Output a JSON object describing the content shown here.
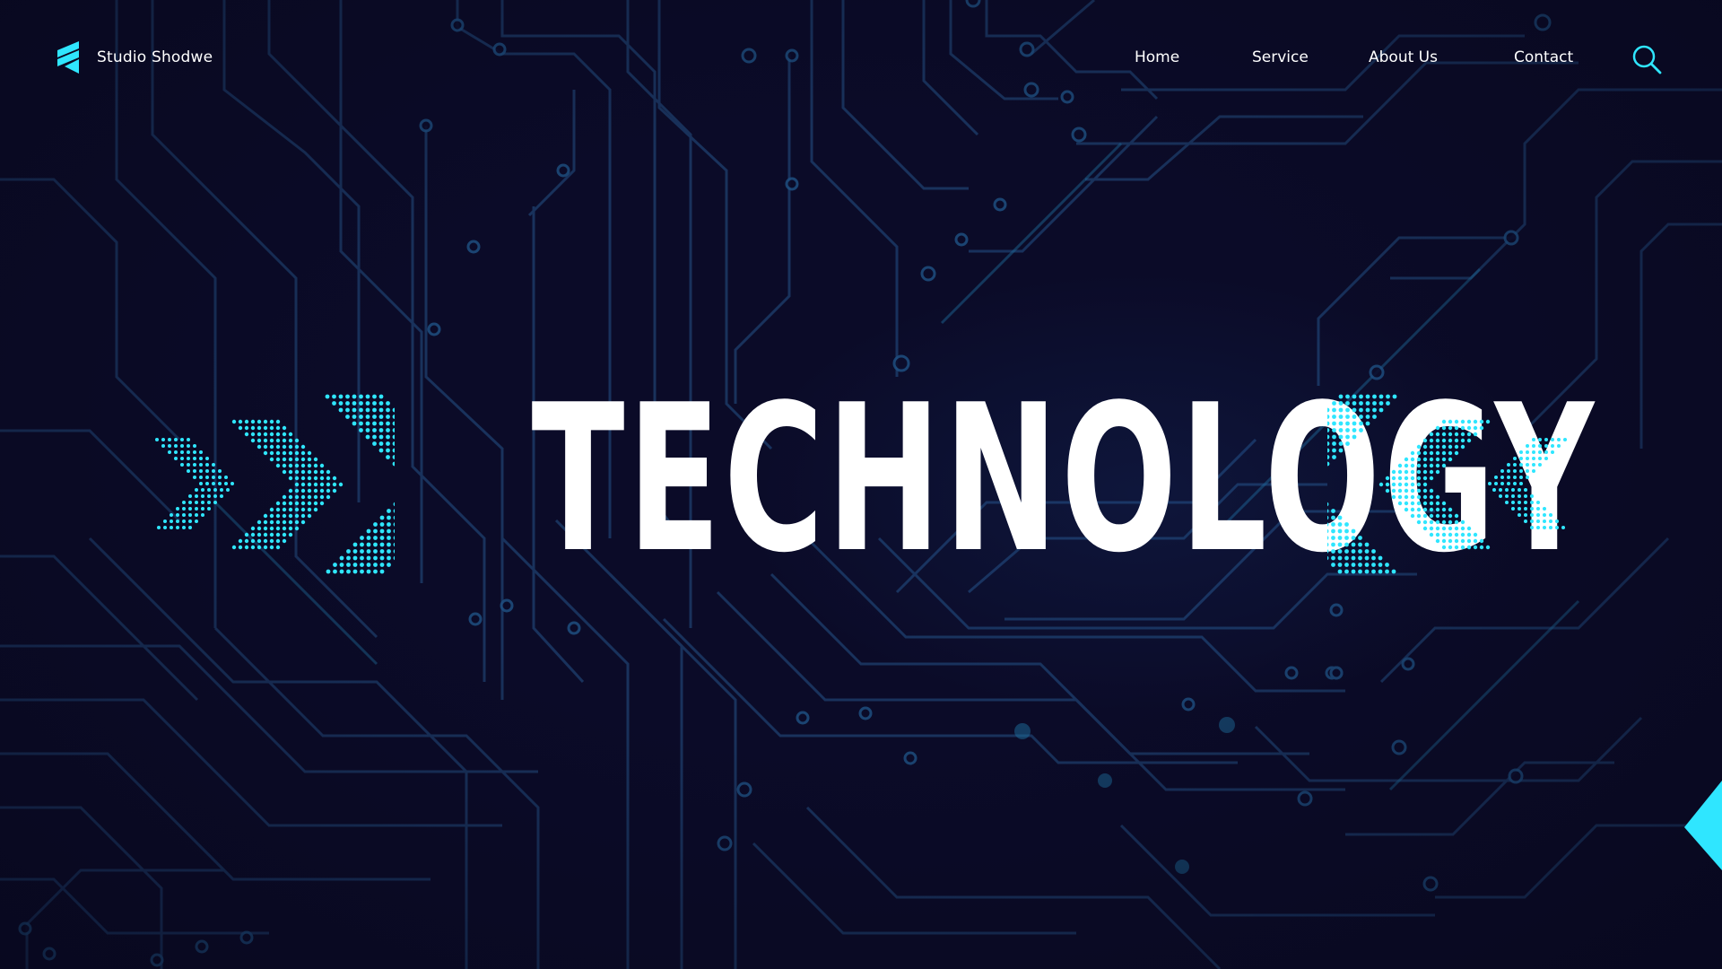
{
  "brand": {
    "name": "Studio Shodwe",
    "logo_icon": "stacked-stripes-logo-icon"
  },
  "nav": {
    "items": [
      {
        "label": "Home"
      },
      {
        "label": "Service"
      },
      {
        "label": "About Us"
      },
      {
        "label": "Contact"
      }
    ],
    "search_icon": "search-icon"
  },
  "hero": {
    "title": "TECHNOLOGY"
  },
  "decor": {
    "left_arrows": "dotted-chevron-right-icons",
    "right_arrows": "dotted-chevron-left-icons",
    "background": "circuit-board-pattern"
  },
  "colors": {
    "background": "#0b0b28",
    "accent": "#2fe6ff",
    "circuit": "#1e3f6e",
    "text": "#ffffff"
  }
}
